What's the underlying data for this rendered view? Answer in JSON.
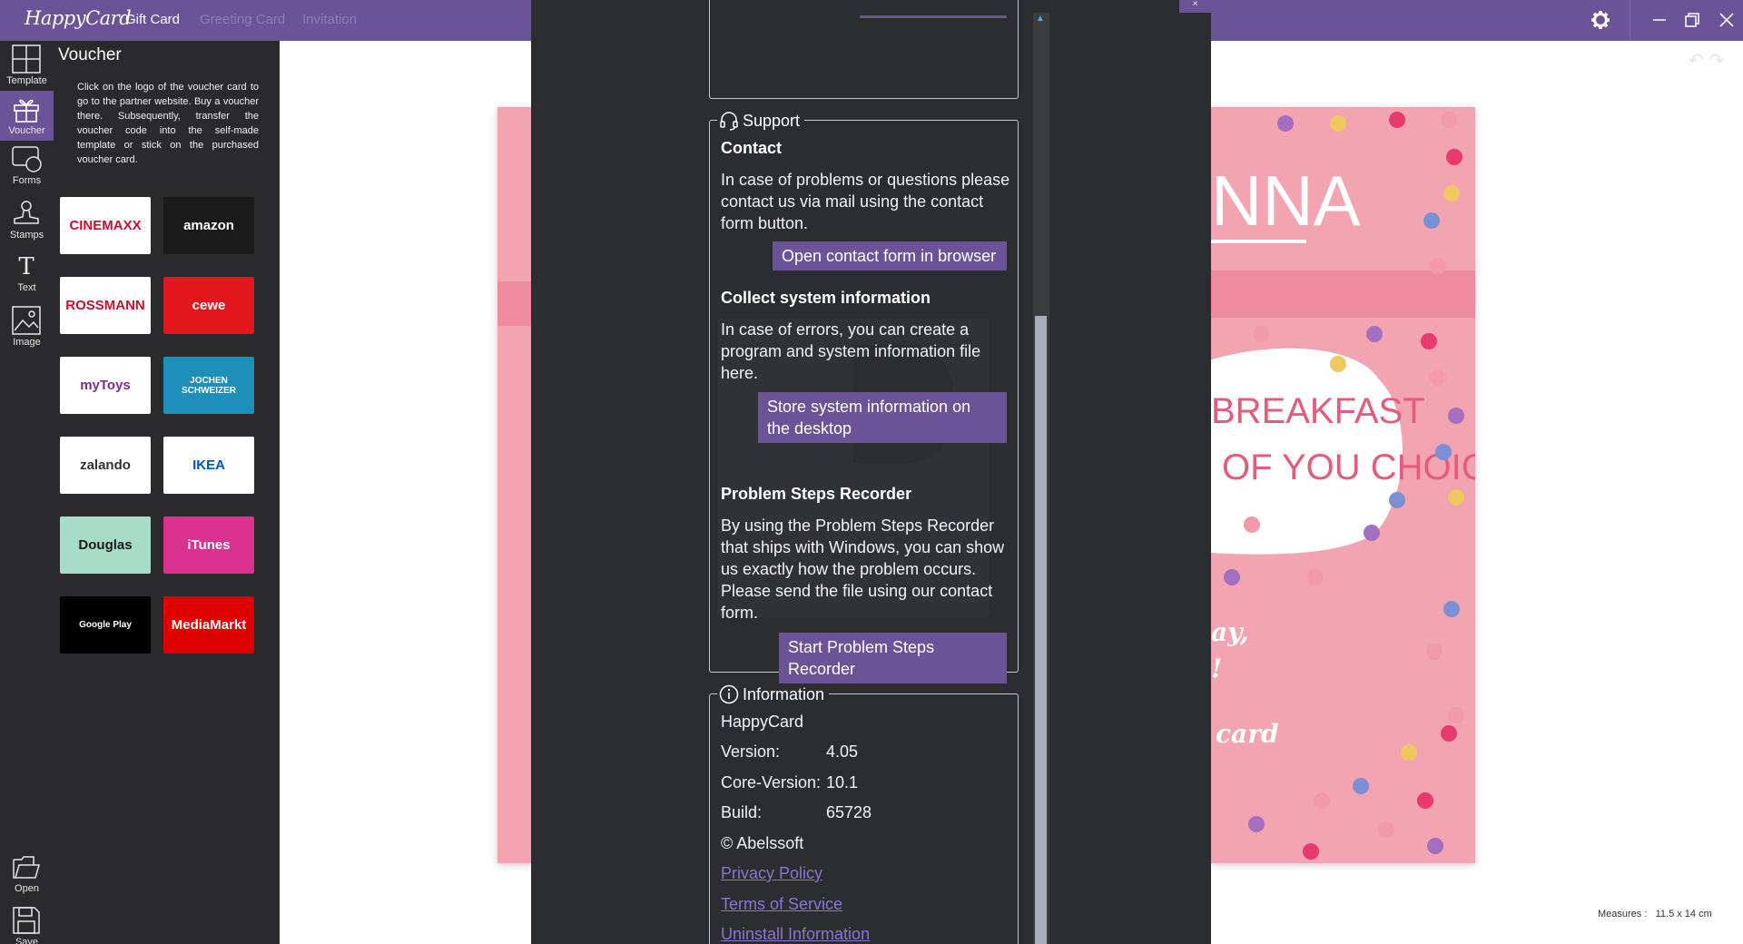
{
  "app": {
    "logo_text": "HappyCard",
    "tabs": [
      {
        "label": "Gift Card",
        "active": true
      },
      {
        "label": "Greeting Card",
        "active": false
      },
      {
        "label": "Invitation",
        "active": false
      }
    ]
  },
  "rail": {
    "tools": [
      {
        "label": "Template",
        "icon": "template-grid-icon"
      },
      {
        "label": "Voucher",
        "icon": "gift-icon",
        "active": true
      },
      {
        "label": "Forms",
        "icon": "shapes-icon"
      },
      {
        "label": "Stamps",
        "icon": "stamp-icon"
      },
      {
        "label": "Text",
        "icon": "text-icon"
      },
      {
        "label": "Image",
        "icon": "image-icon"
      }
    ],
    "open_label": "Open",
    "save_label": "Save"
  },
  "panel": {
    "title": "Voucher",
    "description": "Click on the logo of the voucher card to go to the partner website. Buy a voucher there. Subsequently, transfer the voucher code into the self-made template or stick on the purchased voucher card.",
    "vouchers": [
      {
        "name": "CINEMAXX",
        "bg": "#ffffff",
        "fg": "#c8102e"
      },
      {
        "name": "amazon",
        "bg": "#1a1a1a",
        "fg": "#ffffff"
      },
      {
        "name": "ROSSMANN",
        "bg": "#ffffff",
        "fg": "#c8102e"
      },
      {
        "name": "cewe",
        "bg": "#e3161c",
        "fg": "#ffffff"
      },
      {
        "name": "myToys",
        "bg": "#ffffff",
        "fg": "#7b2d8e"
      },
      {
        "name": "JOCHEN SCHWEIZER",
        "bg": "#1e8fb8",
        "fg": "#ffffff"
      },
      {
        "name": "zalando",
        "bg": "#ffffff",
        "fg": "#333333"
      },
      {
        "name": "IKEA",
        "bg": "#ffffff",
        "fg": "#0051ba"
      },
      {
        "name": "Douglas",
        "bg": "#a7dcc9",
        "fg": "#1a1a1a"
      },
      {
        "name": "iTunes",
        "bg": "#d9328f",
        "fg": "#ffffff"
      },
      {
        "name": "Google Play",
        "bg": "#000000",
        "fg": "#ffffff"
      },
      {
        "name": "MediaMarkt",
        "bg": "#df0000",
        "fg": "#ffffff"
      }
    ]
  },
  "card": {
    "name_fragment": "NNA",
    "line1": "BREAKFAST",
    "line2": "OF YOU CHOICE",
    "line3": "ay,",
    "line4": "!",
    "line5": "card",
    "colors": {
      "background": "#f2a4b1",
      "band": "#ee8b9f",
      "text": "#e35d7b"
    }
  },
  "measures": {
    "label": "Measures :",
    "value": "11.5 x 14 cm"
  },
  "dialog": {
    "support": {
      "legend": "Support",
      "contact_title": "Contact",
      "contact_text": "In case of problems or questions please contact us via mail using the contact form button.",
      "contact_button": "Open contact form in browser",
      "sysinfo_title": "Collect system information",
      "sysinfo_text": "In case of errors, you can create a program and system information file here.",
      "sysinfo_button": "Store system information on the desktop",
      "psr_title": "Problem Steps Recorder",
      "psr_text": "By using the Problem Steps Recorder that ships with Windows, you can show us exactly how the problem occurs. Please send the file using our contact form.",
      "psr_button": "Start Problem Steps Recorder"
    },
    "information": {
      "legend": "Information",
      "product": "HappyCard",
      "version_label": "Version:",
      "version_value": "4.05",
      "core_label": "Core-Version:",
      "core_value": "10.1",
      "build_label": "Build:",
      "build_value": "65728",
      "copyright": "©  Abelssoft",
      "privacy_link": "Privacy Policy",
      "terms_link": "Terms of Service",
      "uninstall_link": "Uninstall Information"
    }
  },
  "colors": {
    "accent": "#6b5397",
    "dialog_bg": "#2b2d30",
    "link": "#8c74d3"
  }
}
